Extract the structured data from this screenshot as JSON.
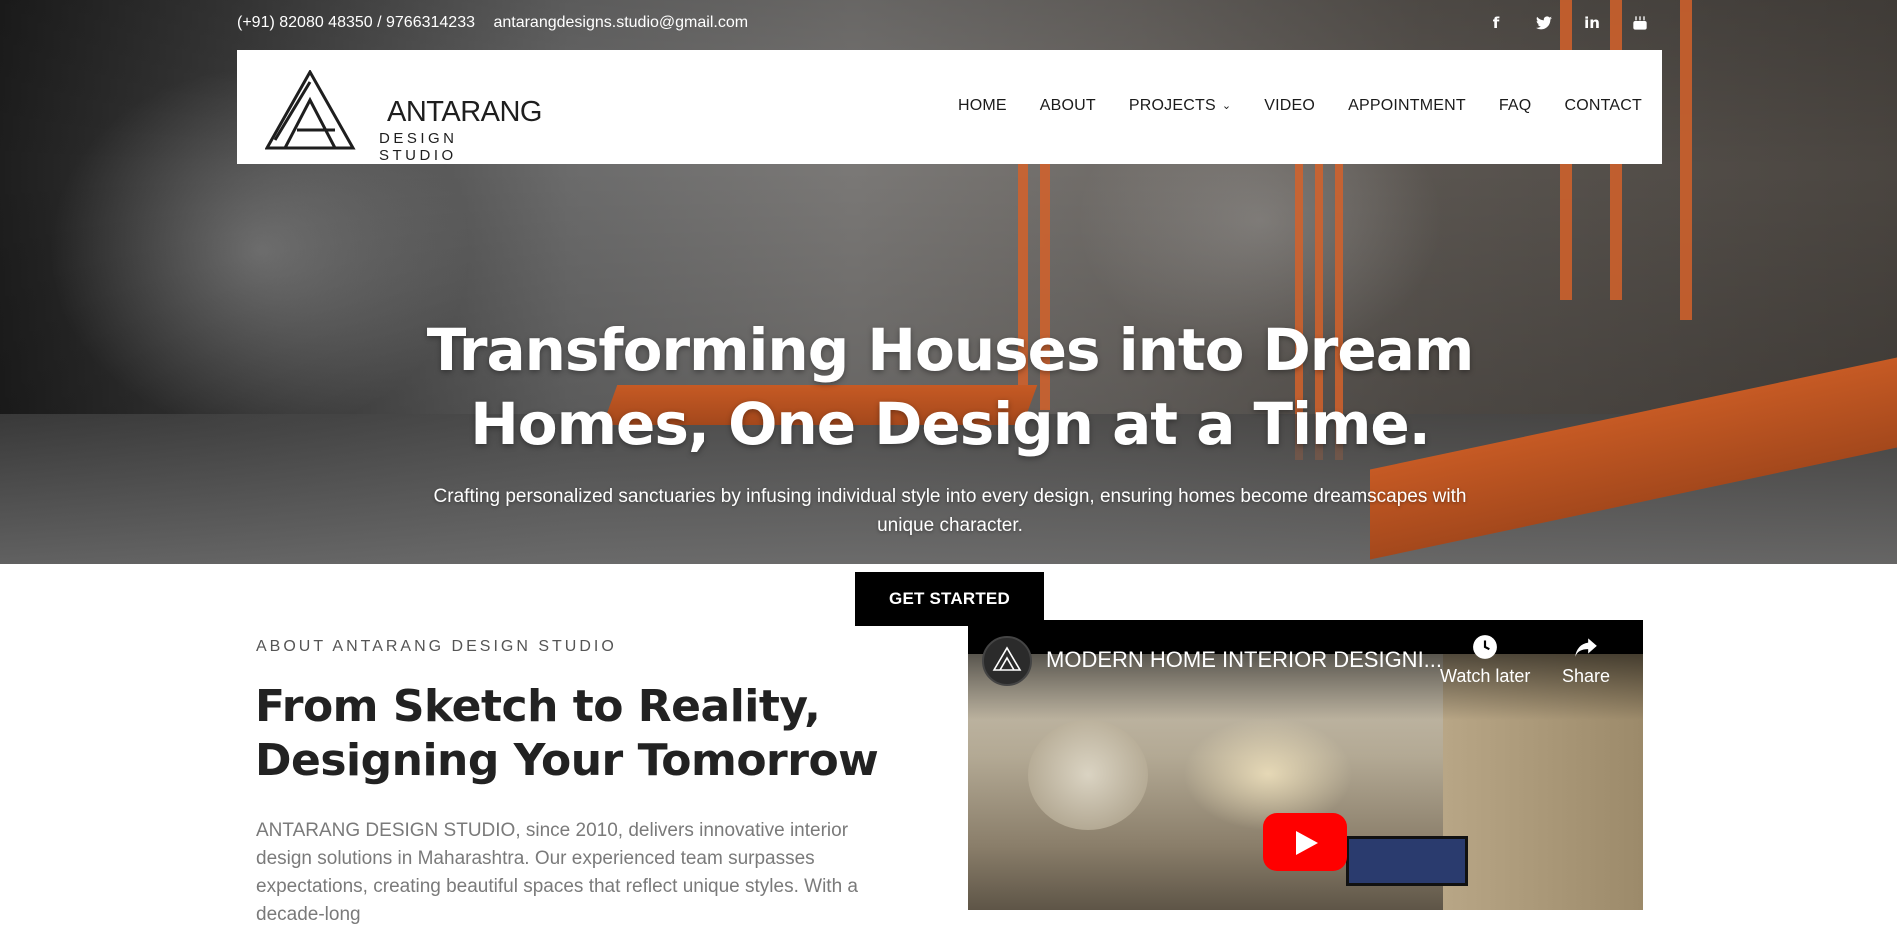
{
  "topbar": {
    "phone": "(+91) 82080 48350 / 9766314233",
    "email": "antarangdesigns.studio@gmail.com",
    "socials": [
      {
        "name": "facebook",
        "glyph": "f"
      },
      {
        "name": "twitter",
        "glyph": "t"
      },
      {
        "name": "linkedin",
        "glyph": "in"
      },
      {
        "name": "youtube",
        "glyph": "▶"
      }
    ]
  },
  "brand": {
    "name": "ANTARANG",
    "tagline": "DESIGN STUDIO"
  },
  "nav": {
    "items": [
      "HOME",
      "ABOUT",
      "PROJECTS",
      "VIDEO",
      "APPOINTMENT",
      "FAQ",
      "CONTACT"
    ]
  },
  "hero": {
    "title": "Transforming Houses into Dream Homes, One Design at a Time.",
    "subtitle": "Crafting personalized sanctuaries by infusing individual style into every design, ensuring homes become dreamscapes with unique character.",
    "cta": "GET STARTED"
  },
  "about": {
    "kicker": "ABOUT ANTARANG DESIGN STUDIO",
    "title": "From Sketch to Reality, Designing Your Tomorrow",
    "body": "ANTARANG DESIGN STUDIO, since 2010, delivers innovative interior design solutions in Maharashtra. Our experienced team surpasses expectations, creating beautiful spaces that reflect unique styles. With a decade-long"
  },
  "video": {
    "title": "MODERN HOME INTERIOR DESIGNI...",
    "watch_later": "Watch later",
    "share": "Share"
  },
  "colors": {
    "accent_orange": "#d4622a",
    "cta_bg": "#000000",
    "youtube_red": "#ff0000"
  }
}
